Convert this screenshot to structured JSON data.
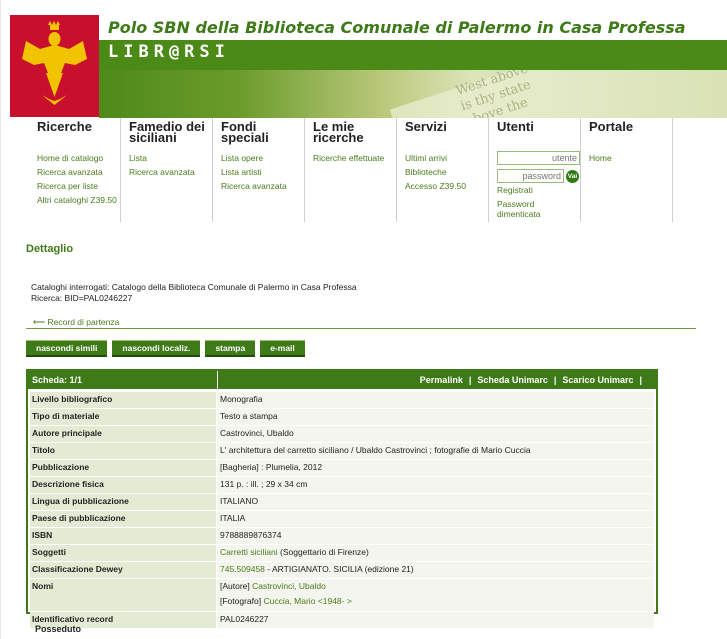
{
  "header": {
    "title": "Polo SBN della Biblioteca Comunale di Palermo in Casa Professa",
    "brand": "LIBR@RSI",
    "banner_text": [
      "West above the",
      "is thy state",
      "above the"
    ],
    "logo_color": "#c8102e"
  },
  "nav": [
    {
      "head": "Ricerche",
      "links": [
        "Home di catalogo",
        "Ricerca avanzata",
        "Ricerca per liste",
        "Altri cataloghi Z39.50"
      ]
    },
    {
      "head": "Famedio dei siciliani",
      "links": [
        "Lista",
        "Ricerca avanzata"
      ]
    },
    {
      "head": "Fondi speciali",
      "links": [
        "Lista opere",
        "Lista artisti",
        "Ricerca avanzata"
      ]
    },
    {
      "head": "Le mie ricerche",
      "links": [
        "Ricerche effettuate"
      ]
    },
    {
      "head": "Servizi",
      "links": [
        "Ultimi arrivi",
        "Biblioteche",
        "Accesso Z39.50"
      ]
    },
    {
      "head": "Utenti",
      "user_placeholder": "utente",
      "password_placeholder": "password",
      "go": "Vai",
      "links": [
        "Registrati",
        "Password dimenticata"
      ]
    },
    {
      "head": "Portale",
      "links": [
        "Home"
      ]
    }
  ],
  "page": {
    "heading": "Dettaglio",
    "cataloghi": "Cataloghi interrogati: Catalogo della Biblioteca Comunale di Palermo in Casa Professa",
    "ricerca": "Ricerca: BID=PAL0246227",
    "back": "⟵ Record di partenza",
    "buttons": [
      "nascondi simili",
      "nascondi localiz.",
      "stampa",
      "e-mail"
    ],
    "scheda": "Scheda: 1/1",
    "actions": [
      "Permalink",
      "Scheda Unimarc",
      "Scarico Unimarc"
    ],
    "sep": "|",
    "posseduto": "Posseduto"
  },
  "record": [
    {
      "label": "Livello bibliografico",
      "value": "Monografia"
    },
    {
      "label": "Tipo di materiale",
      "value": "Testo a stampa"
    },
    {
      "label": "Autore principale",
      "value": "Castrovinci, Ubaldo"
    },
    {
      "label": "Titolo",
      "value": "L' architettura del carretto siciliano / Ubaldo Castrovinci ; fotografie di Mario Cuccia"
    },
    {
      "label": "Pubblicazione",
      "value": "[Bagheria] : Plumelia, 2012"
    },
    {
      "label": "Descrizione fisica",
      "value": "131 p. : ill. ; 29 x 34 cm"
    },
    {
      "label": "Lingua di pubblicazione",
      "value": "ITALIANO"
    },
    {
      "label": "Paese di pubblicazione",
      "value": "ITALIA"
    },
    {
      "label": "ISBN",
      "value": "9788889876374"
    },
    {
      "label": "Soggetti",
      "link": "Carretti siciliani",
      "value": " (Soggettario di Firenze)"
    },
    {
      "label": "Classificazione Dewey",
      "link": "745.509458",
      "value": " - ARTIGIANATO. SICILIA (edizione 21)"
    },
    {
      "label": "Nomi",
      "prefix1": "[Autore] ",
      "link1": "Castrovinci, Ubaldo",
      "prefix2": "[Fotografo] ",
      "link2": "Cuccia, Mario <1948- >"
    },
    {
      "label": "Identificativo record",
      "value": "PAL0246227"
    }
  ]
}
